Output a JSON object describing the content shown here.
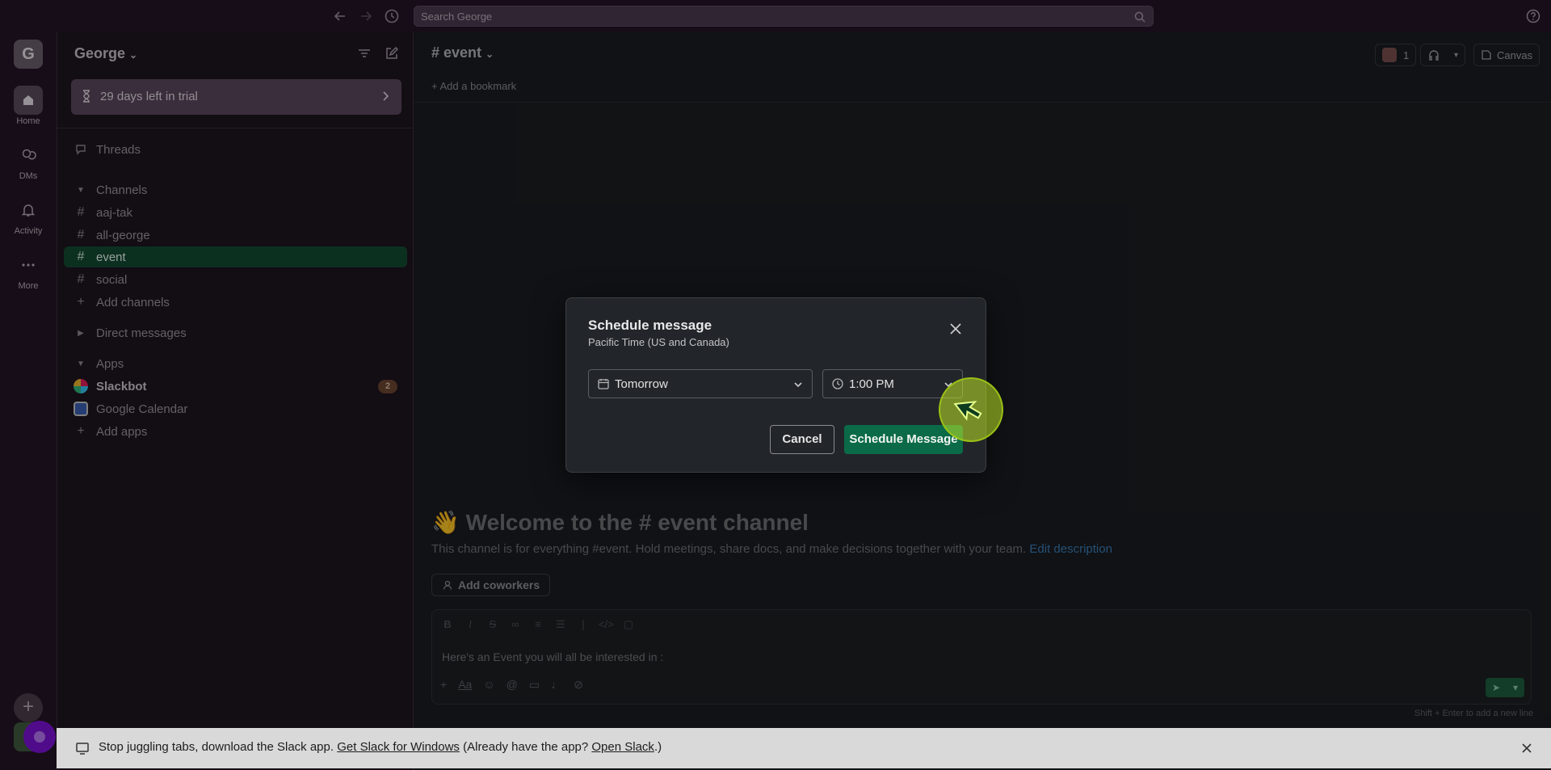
{
  "topbar": {
    "search_placeholder": "Search George"
  },
  "rail": {
    "workspace_initial": "G",
    "items": [
      {
        "label": "Home",
        "icon": "home-icon"
      },
      {
        "label": "DMs",
        "icon": "dm-icon"
      },
      {
        "label": "Activity",
        "icon": "bell-icon"
      },
      {
        "label": "More",
        "icon": "more-icon"
      }
    ]
  },
  "sidebar": {
    "workspace_name": "George",
    "trial_label": "29 days left in trial",
    "threads_label": "Threads",
    "channels_header": "Channels",
    "channels": [
      "aaj-tak",
      "all-george",
      "event",
      "social"
    ],
    "active_channel": "event",
    "add_channels": "Add channels",
    "dm_header": "Direct messages",
    "apps_header": "Apps",
    "apps": [
      {
        "name": "Slackbot",
        "badge": "2"
      },
      {
        "name": "Google Calendar",
        "badge": ""
      }
    ],
    "add_apps": "Add apps"
  },
  "channel": {
    "name": "event",
    "add_bookmark": "Add a bookmark",
    "member_count": "1",
    "canvas_label": "Canvas",
    "welcome_emoji": "👋",
    "welcome_title_prefix": "Welcome to the",
    "welcome_title_channel": "event channel",
    "welcome_desc": "This channel is for everything #event. Hold meetings, share docs, and make decisions together with your team.",
    "edit_description": "Edit description",
    "add_coworkers": "Add coworkers"
  },
  "composer": {
    "text": "Here's an Event you will all be interested in :",
    "hint": "Shift + Enter to add a new line"
  },
  "modal": {
    "title": "Schedule message",
    "subtitle": "Pacific Time (US and Canada)",
    "date_value": "Tomorrow",
    "time_value": "1:00 PM",
    "cancel_label": "Cancel",
    "schedule_label": "Schedule Message"
  },
  "banner": {
    "text_before": "Stop juggling tabs, download the Slack app.",
    "link1": "Get Slack for Windows",
    "text_middle": "(Already have the app?",
    "link2": "Open Slack",
    "text_after": ".)"
  }
}
